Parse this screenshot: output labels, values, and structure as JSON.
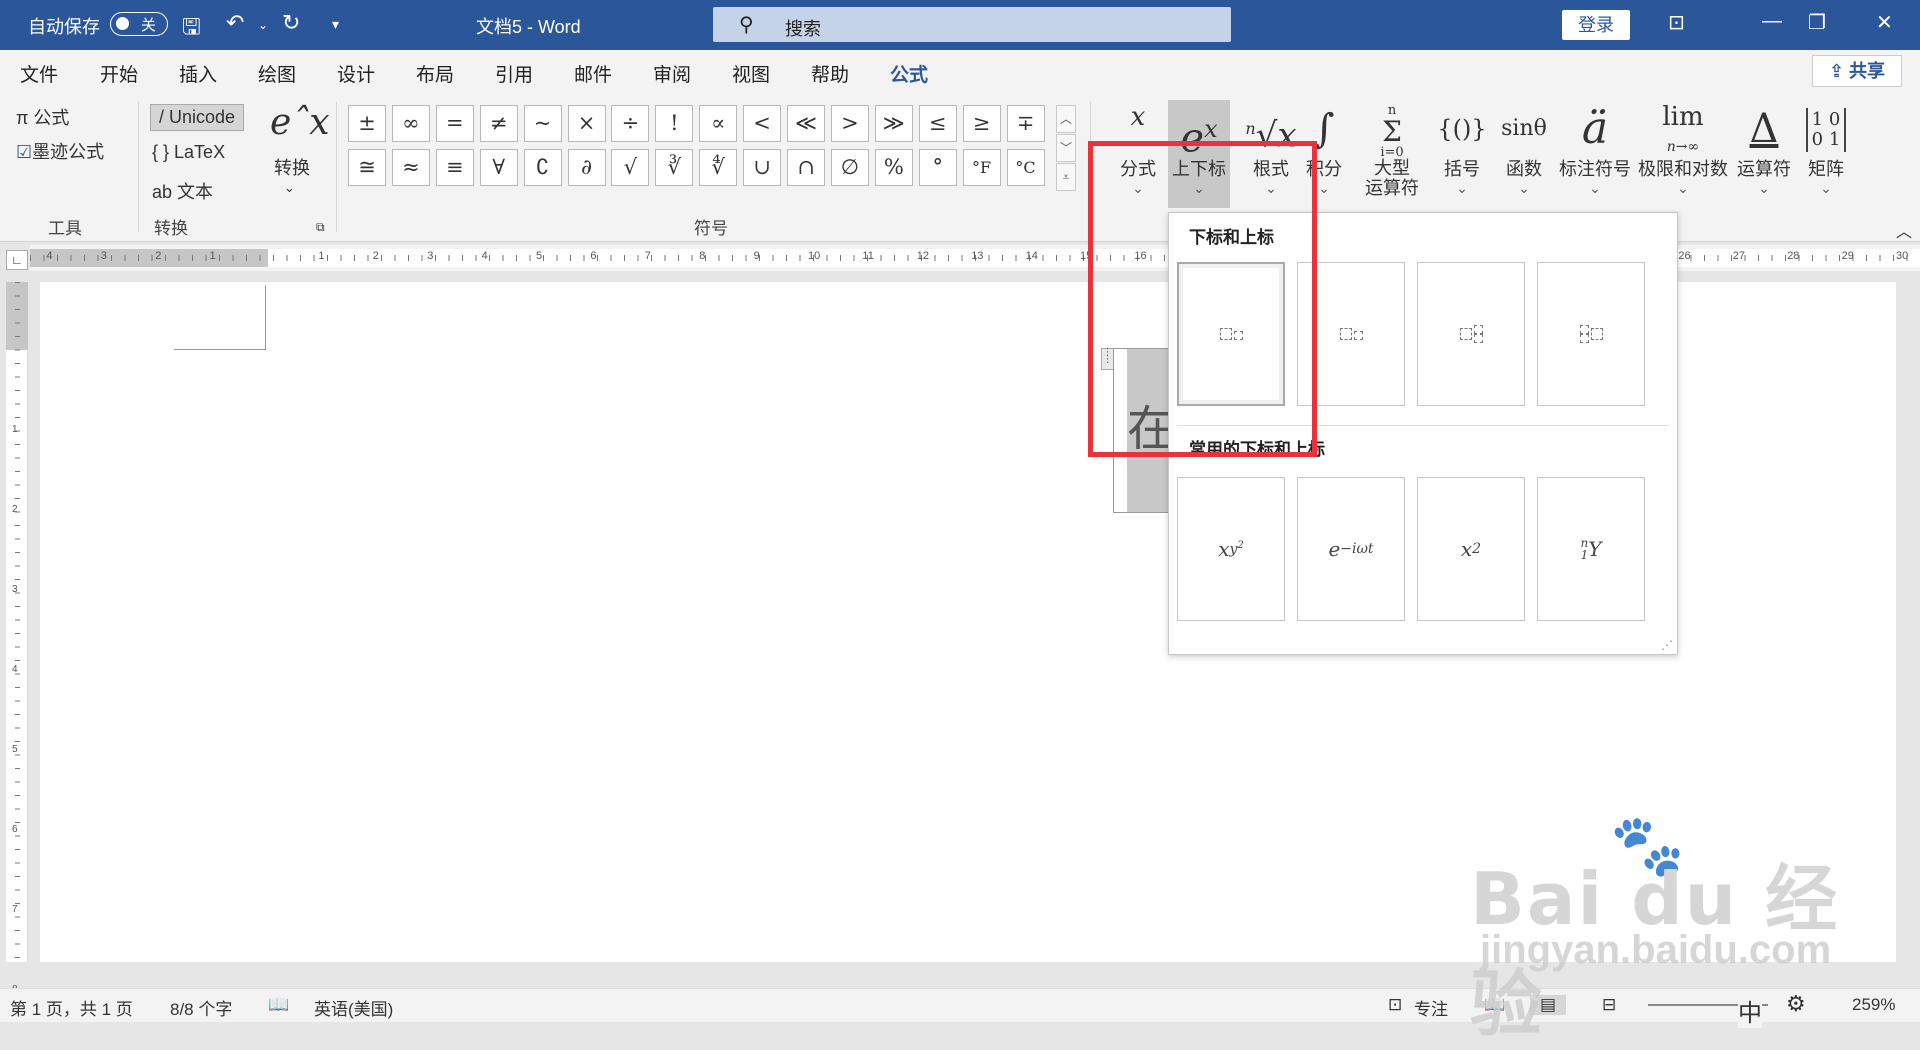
{
  "titlebar": {
    "autosave_label": "自动保存",
    "autosave_state": "关",
    "doc_title": "文档5  -  Word",
    "search_placeholder": "搜索",
    "login": "登录"
  },
  "tabs": [
    "文件",
    "开始",
    "插入",
    "绘图",
    "设计",
    "布局",
    "引用",
    "邮件",
    "审阅",
    "视图",
    "帮助",
    "公式"
  ],
  "active_tab": "公式",
  "share": "共享",
  "ribbon": {
    "tools": {
      "equation": "π 公式",
      "ink": "墨迹公式",
      "group": "工具"
    },
    "convert": {
      "unicode": "Unicode",
      "latex": "LaTeX",
      "text": "ab 文本",
      "convert_btn": "转换",
      "group": "转换"
    },
    "symbols_group": "符号",
    "symbols_row1": [
      "±",
      "∞",
      "=",
      "≠",
      "~",
      "×",
      "÷",
      "!",
      "∝",
      "<",
      "≪",
      ">",
      "≫",
      "≤",
      "≥",
      "∓"
    ],
    "symbols_row2": [
      "≅",
      "≈",
      "≡",
      "∀",
      "∁",
      "∂",
      "√",
      "∛",
      "∜",
      "∪",
      "∩",
      "∅",
      "%",
      "°",
      "°F",
      "°C"
    ],
    "structures": [
      {
        "label": "分式",
        "icon": "x/y"
      },
      {
        "label": "上下标",
        "icon": "eˣ"
      },
      {
        "label": "根式",
        "icon": "ⁿ√x"
      },
      {
        "label": "积分",
        "icon": "∫ˣ₋ₓ"
      },
      {
        "label": "大型\n运算符",
        "icon": "Σ"
      },
      {
        "label": "括号",
        "icon": "{()}"
      },
      {
        "label": "函数",
        "icon": "sinθ"
      },
      {
        "label": "标注符号",
        "icon": "ä"
      },
      {
        "label": "极限和对数",
        "icon": "lim"
      },
      {
        "label": "运算符",
        "icon": "Δ"
      },
      {
        "label": "矩阵",
        "icon": "[10 01]"
      }
    ],
    "limit_sub": "n→∞",
    "sum_sub": "i=0",
    "sum_sup": "n"
  },
  "dropdown": {
    "header1": "下标和上标",
    "header2": "常用的下标和上标",
    "common": [
      "x_{y²}",
      "e^{−iωt}",
      "x²",
      "ⁿ₁Y"
    ]
  },
  "document": {
    "equation_char": "在"
  },
  "statusbar": {
    "page": "第 1 页，共 1 页",
    "words": "8/8 个字",
    "language": "英语(美国)",
    "focus": "专注",
    "ime": "中",
    "zoom": "259%"
  },
  "watermark": {
    "brand": "Bai du 经验",
    "url": "jingyan.baidu.com"
  }
}
